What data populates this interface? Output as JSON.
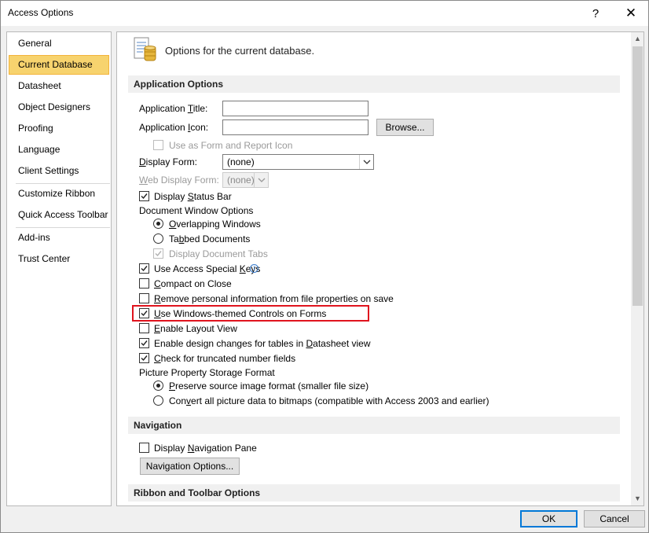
{
  "window": {
    "title": "Access Options",
    "help_glyph": "?",
    "close_glyph": "✕"
  },
  "nav": {
    "items": [
      {
        "label": "General"
      },
      {
        "label": "Current Database"
      },
      {
        "label": "Datasheet"
      },
      {
        "label": "Object Designers"
      },
      {
        "label": "Proofing"
      },
      {
        "label": "Language"
      },
      {
        "label": "Client Settings"
      },
      {
        "label": "Customize Ribbon"
      },
      {
        "label": "Quick Access Toolbar"
      },
      {
        "label": "Add-ins"
      },
      {
        "label": "Trust Center"
      }
    ],
    "selected": "Current Database"
  },
  "header": {
    "text": "Options for the current database."
  },
  "app_options": {
    "section_title": "Application Options",
    "app_title_label": "Application Title:",
    "app_title_value": "",
    "app_icon_label": "Application Icon:",
    "app_icon_value": "",
    "browse_label": "Browse...",
    "use_as_icon_label": "Use as Form and Report Icon",
    "display_form_label": "Display Form:",
    "display_form_value": "(none)",
    "web_display_form_label": "Web Display Form:",
    "web_display_form_value": "(none)",
    "display_status_bar_label": "Display Status Bar",
    "doc_window_options_label": "Document Window Options",
    "overlapping_windows_label": "Overlapping Windows",
    "tabbed_documents_label": "Tabbed Documents",
    "display_document_tabs_label": "Display Document Tabs",
    "use_special_keys_label": "Use Access Special Keys",
    "compact_on_close_label": "Compact on Close",
    "remove_personal_label": "Remove personal information from file properties on save",
    "windows_themed_label": "Use Windows-themed Controls on Forms",
    "enable_layout_view_label": "Enable Layout View",
    "enable_design_changes_label": "Enable design changes for tables in Datasheet view",
    "check_truncated_label": "Check for truncated number fields",
    "picture_storage_label": "Picture Property Storage Format",
    "preserve_source_label": "Preserve source image format (smaller file size)",
    "convert_bitmaps_label": "Convert all picture data to bitmaps (compatible with Access 2003 and earlier)",
    "checked": {
      "use_as_icon": false,
      "display_status_bar": true,
      "overlapping_windows": true,
      "tabbed_documents": false,
      "display_document_tabs": true,
      "use_special_keys": true,
      "compact_on_close": false,
      "remove_personal": false,
      "windows_themed": true,
      "enable_layout_view": false,
      "enable_design_changes": true,
      "check_truncated": true,
      "preserve_source": true,
      "convert_bitmaps": false
    }
  },
  "navigation": {
    "section_title": "Navigation",
    "display_nav_pane_label": "Display Navigation Pane",
    "display_nav_pane_checked": false,
    "nav_options_label": "Navigation Options..."
  },
  "ribbon": {
    "section_title": "Ribbon and Toolbar Options"
  },
  "footer": {
    "ok_label": "OK",
    "cancel_label": "Cancel"
  },
  "colors": {
    "selected_nav_bg": "#f7d36e",
    "highlight_border": "#e0141e",
    "ok_border": "#0078d7"
  },
  "icons": {
    "database": "database-options-icon",
    "info": "info-icon"
  }
}
